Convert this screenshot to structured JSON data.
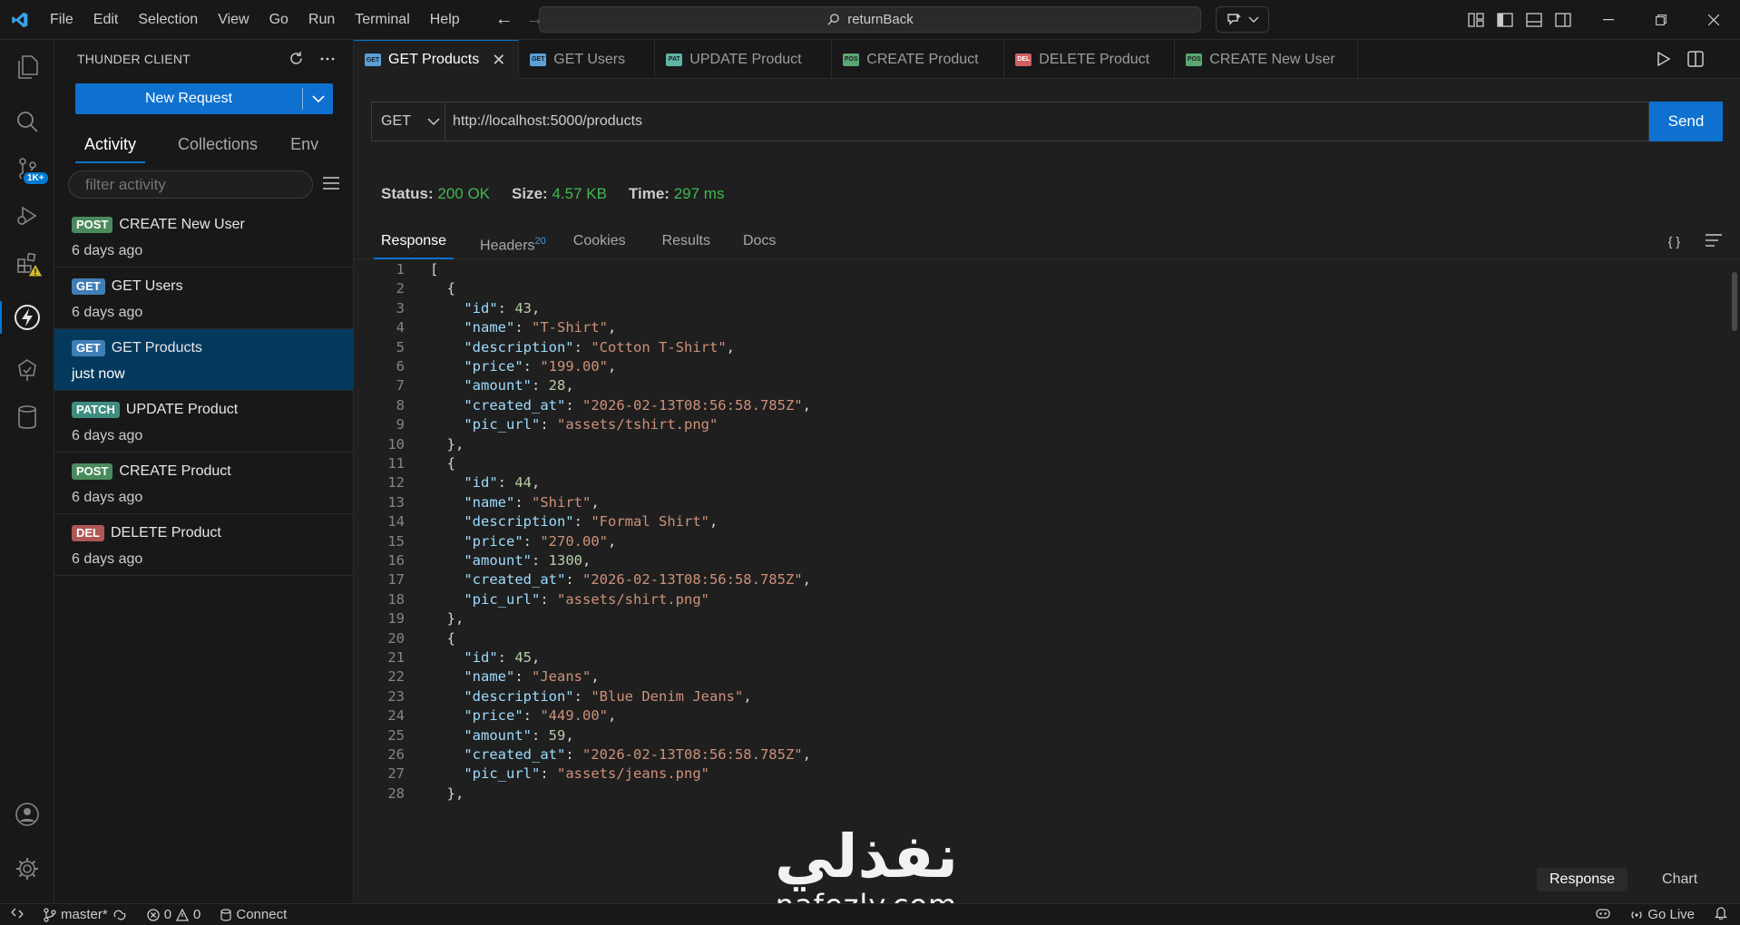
{
  "menu": [
    "File",
    "Edit",
    "Selection",
    "View",
    "Go",
    "Run",
    "Terminal",
    "Help"
  ],
  "command_center": "returnBack",
  "sidebar": {
    "title": "THUNDER CLIENT",
    "new_request": "New Request",
    "tabs": [
      "Activity",
      "Collections",
      "Env"
    ],
    "filter_placeholder": "filter activity",
    "activity": [
      {
        "method": "POST",
        "name": "CREATE New User",
        "time": "6 days ago"
      },
      {
        "method": "GET",
        "name": "GET Users",
        "time": "6 days ago"
      },
      {
        "method": "GET",
        "name": "GET Products",
        "time": "just now"
      },
      {
        "method": "PATCH",
        "name": "UPDATE Product",
        "time": "6 days ago"
      },
      {
        "method": "POST",
        "name": "CREATE Product",
        "time": "6 days ago"
      },
      {
        "method": "DEL",
        "name": "DELETE Product",
        "time": "6 days ago"
      }
    ]
  },
  "activity_bar": {
    "scm_badge": "1K+"
  },
  "editor_tabs": [
    {
      "icon": "GET",
      "label": "GET Products"
    },
    {
      "icon": "GET",
      "label": "GET Users"
    },
    {
      "icon": "PAT",
      "label": "UPDATE Product"
    },
    {
      "icon": "POS",
      "label": "CREATE Product"
    },
    {
      "icon": "DEL",
      "label": "DELETE Product"
    },
    {
      "icon": "POS",
      "label": "CREATE New User"
    }
  ],
  "request": {
    "method": "GET",
    "url": "http://localhost:5000/products",
    "send": "Send"
  },
  "status": {
    "status_label": "Status:",
    "status": "200 OK",
    "size_label": "Size:",
    "size": "4.57 KB",
    "time_label": "Time:",
    "time": "297 ms"
  },
  "response_tabs": {
    "response": "Response",
    "headers": "Headers",
    "headers_count": "20",
    "cookies": "Cookies",
    "results": "Results",
    "docs": "Docs",
    "format": "{ }"
  },
  "response_body": [
    "[",
    "  {",
    "    \"id\": 43,",
    "    \"name\": \"T-Shirt\",",
    "    \"description\": \"Cotton T-Shirt\",",
    "    \"price\": \"199.00\",",
    "    \"amount\": 28,",
    "    \"created_at\": \"2026-02-13T08:56:58.785Z\",",
    "    \"pic_url\": \"assets/tshirt.png\"",
    "  },",
    "  {",
    "    \"id\": 44,",
    "    \"name\": \"Shirt\",",
    "    \"description\": \"Formal Shirt\",",
    "    \"price\": \"270.00\",",
    "    \"amount\": 1300,",
    "    \"created_at\": \"2026-02-13T08:56:58.785Z\",",
    "    \"pic_url\": \"assets/shirt.png\"",
    "  },",
    "  {",
    "    \"id\": 45,",
    "    \"name\": \"Jeans\",",
    "    \"description\": \"Blue Denim Jeans\",",
    "    \"price\": \"449.00\",",
    "    \"amount\": 59,",
    "    \"created_at\": \"2026-02-13T08:56:58.785Z\",",
    "    \"pic_url\": \"assets/jeans.png\"",
    "  },"
  ],
  "view_toggle": {
    "response": "Response",
    "chart": "Chart"
  },
  "watermark": {
    "arabic": "نفذلي",
    "latin": "nafezly.com"
  },
  "statusbar": {
    "branch": "master*",
    "errors": "0",
    "warnings": "0",
    "connect": "Connect",
    "go_live": "Go Live"
  },
  "colors": {
    "accent": "#0e71d0",
    "status_ok": "#3fb950",
    "selected_row": "#04395e"
  }
}
